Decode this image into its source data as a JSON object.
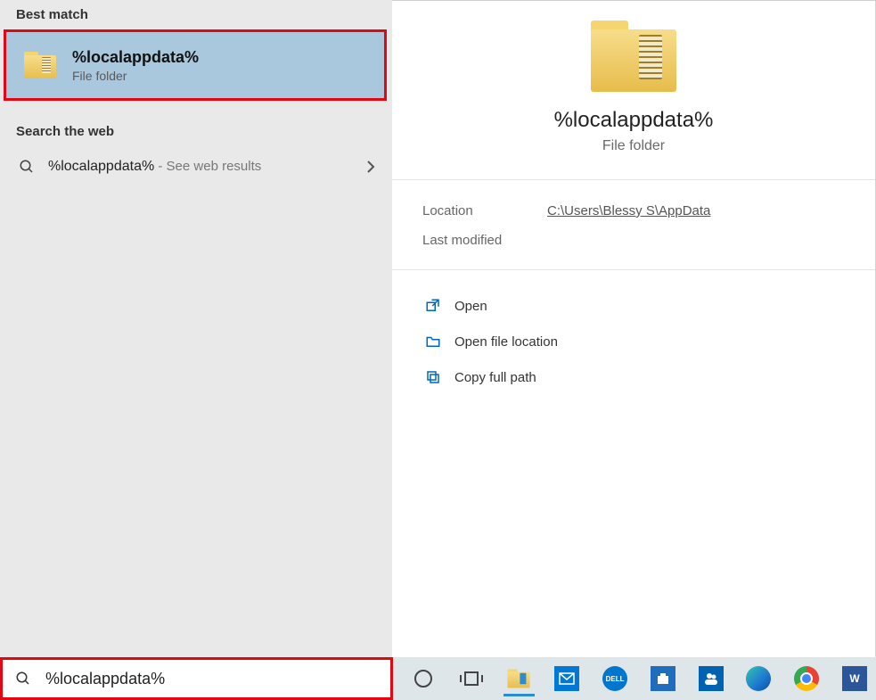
{
  "left": {
    "best_match_header": "Best match",
    "best_match": {
      "title": "%localappdata%",
      "subtitle": "File folder"
    },
    "web_header": "Search the web",
    "web_row": {
      "query": "%localappdata%",
      "hint": " - See web results"
    }
  },
  "preview": {
    "title": "%localappdata%",
    "subtitle": "File folder",
    "meta": {
      "location_label": "Location",
      "location_value": "C:\\Users\\Blessy S\\AppData",
      "modified_label": "Last modified",
      "modified_value": ""
    },
    "actions": {
      "open": "Open",
      "open_location": "Open file location",
      "copy_path": "Copy full path"
    }
  },
  "search": {
    "value": "%localappdata%"
  },
  "taskbar": {
    "cortana": "cortana",
    "taskview": "taskview",
    "explorer": "explorer",
    "mail": "mail",
    "dell": "dell",
    "store": "store",
    "people": "people",
    "edge": "edge",
    "chrome": "chrome",
    "word": "word-app"
  }
}
